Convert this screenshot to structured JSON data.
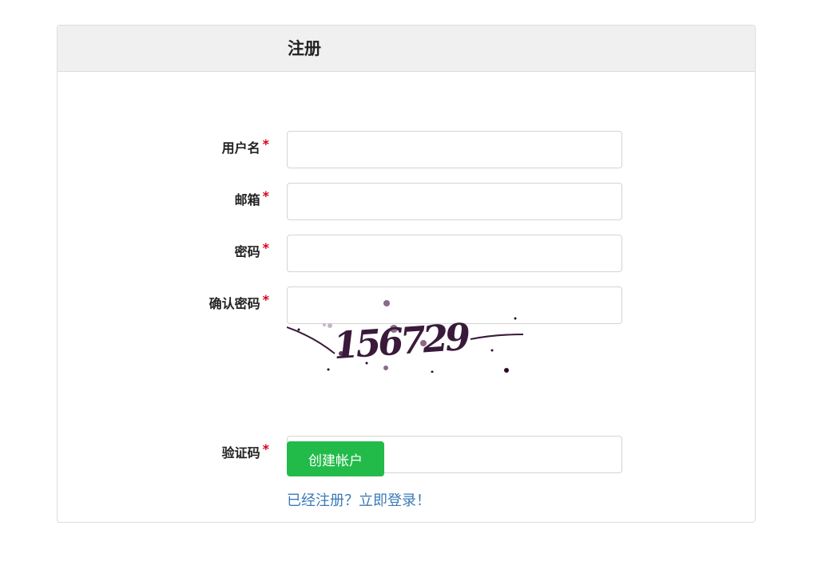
{
  "panel": {
    "title": "注册"
  },
  "form": {
    "required_mark": "*",
    "fields": [
      {
        "label": "用户名",
        "value": "",
        "placeholder": ""
      },
      {
        "label": "邮箱",
        "value": "",
        "placeholder": ""
      },
      {
        "label": "密码",
        "value": "",
        "placeholder": ""
      },
      {
        "label": "确认密码",
        "value": "",
        "placeholder": ""
      }
    ],
    "captcha": {
      "label": "验证码",
      "value": "",
      "placeholder": "",
      "image_text": "156729"
    },
    "submit_label": "创建帐户",
    "login_link": "已经注册？立即登录！"
  },
  "colors": {
    "accent": "#22bb4a",
    "link": "#3c7ab8",
    "required": "#d9001b"
  }
}
